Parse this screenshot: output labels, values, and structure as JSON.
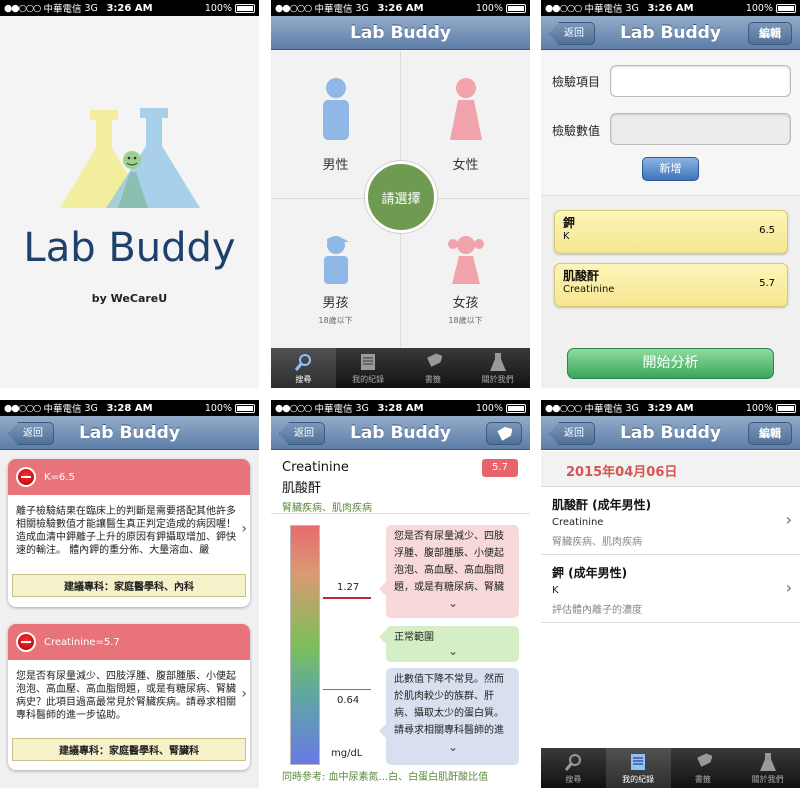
{
  "status": {
    "carrier": "中華電信",
    "network": "3G",
    "battery": "100%",
    "times": [
      "3:26 AM",
      "3:26 AM",
      "3:26 AM",
      "3:28 AM",
      "3:28 AM",
      "3:29 AM"
    ]
  },
  "app_title": "Lab Buddy",
  "splash": {
    "title": "Lab Buddy",
    "byline": "by WeCareU"
  },
  "select": {
    "male": "男性",
    "female": "女性",
    "boy": "男孩",
    "girl": "女孩",
    "boy_sub": "18歲以下",
    "girl_sub": "18歲以下",
    "center": "請選擇"
  },
  "tabs": [
    "搜尋",
    "我的紀錄",
    "書籤",
    "關於我們"
  ],
  "entry": {
    "back": "返回",
    "edit": "編輯",
    "item_label": "檢驗項目",
    "value_label": "檢驗數值",
    "add": "新增",
    "cards": [
      {
        "name": "鉀",
        "code": "K",
        "value": "6.5"
      },
      {
        "name": "肌酸酐",
        "code": "Creatinine",
        "value": "5.7"
      }
    ],
    "analyze": "開始分析"
  },
  "results": {
    "back": "返回",
    "cards": [
      {
        "header": "K=6.5",
        "body": "離子檢驗結果在臨床上的判斷是需要搭配其他許多相關檢驗數值才能讓醫生真正判定造成的病因喔！造成血清中鉀離子上升的原因有鉀攝取增加、鉀快速的輸注。 體內鉀的重分佈、大量溶血、嚴",
        "footer": "建議專科：家庭醫學科、內科"
      },
      {
        "header": "Creatinine=5.7",
        "body": "您是否有尿量減少、四肢浮腫、腹部腫脹、小便起泡泡、高血壓、高血脂問題，或是有糖尿病、腎臟病史？此項目過高最常見於腎臟疾病。請尋求相關專科醫師的進一步協助。",
        "footer": "建議專科：家庭醫學科、腎臟科"
      }
    ]
  },
  "detail": {
    "back": "返回",
    "name_en": "Creatinine",
    "name_zh": "肌酸酐",
    "value": "5.7",
    "related": "腎臟疾病、肌肉疾病",
    "high": "1.27",
    "low": "0.64",
    "unit": "mg/dL",
    "bubble_high": "您是否有尿量減少、四肢浮腫、腹部腫脹、小便起泡泡、高血壓、高血脂問題，或是有糖尿病、腎臟",
    "bubble_normal": "正常範圍",
    "bubble_low": "此數值下降不常見。然而於肌肉較少的族群、肝病、攝取太少的蛋白質。請尋求相關專科醫師的進",
    "footer": "同時參考: 血中尿素氮...白、白蛋白肌酐酸比值"
  },
  "records": {
    "back": "返回",
    "edit": "編輯",
    "date": "2015年04月06日",
    "items": [
      {
        "title": "肌酸酐 (成年男性)",
        "code": "Creatinine",
        "desc": "腎臟疾病、肌肉疾病"
      },
      {
        "title": "鉀 (成年男性)",
        "code": "K",
        "desc": "評估體內離子的濃度"
      }
    ]
  }
}
